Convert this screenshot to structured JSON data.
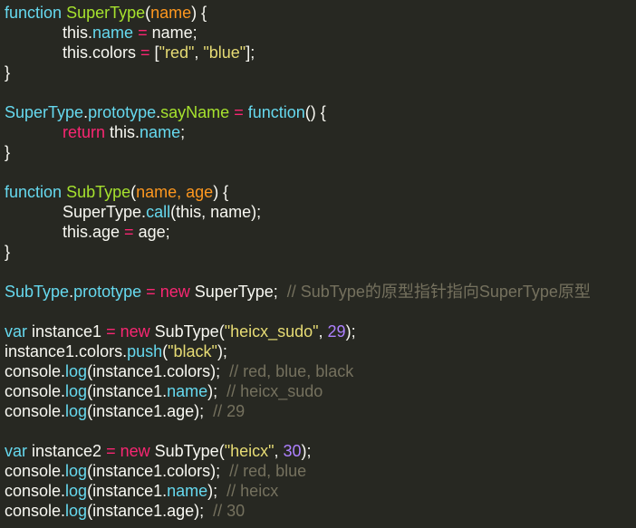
{
  "editor": {
    "theme_colors": {
      "background": "#272822",
      "text": "#f8f8f2",
      "keyword": "#66d9ef",
      "operator": "#f92672",
      "function_name": "#a6e22e",
      "parameter": "#fd971f",
      "string": "#e6db74",
      "number": "#ae81ff",
      "comment": "#75715e"
    },
    "lines": [
      [
        {
          "t": "function",
          "c": "kw-fn"
        },
        {
          "t": " ",
          "c": "plain"
        },
        {
          "t": "SuperType",
          "c": "fn-name"
        },
        {
          "t": "(",
          "c": "plain"
        },
        {
          "t": "name",
          "c": "param"
        },
        {
          "t": ") {",
          "c": "plain"
        }
      ],
      [
        {
          "t": "this.",
          "c": "plain"
        },
        {
          "t": "name",
          "c": "prop"
        },
        {
          "t": " ",
          "c": "plain"
        },
        {
          "t": "=",
          "c": "kw-red"
        },
        {
          "t": " name;",
          "c": "plain"
        }
      ],
      [
        {
          "t": "this.colors ",
          "c": "plain"
        },
        {
          "t": "=",
          "c": "kw-red"
        },
        {
          "t": " [",
          "c": "plain"
        },
        {
          "t": "\"red\"",
          "c": "str"
        },
        {
          "t": ", ",
          "c": "plain"
        },
        {
          "t": "\"blue\"",
          "c": "str"
        },
        {
          "t": "];",
          "c": "plain"
        }
      ],
      [
        {
          "t": "}",
          "c": "plain"
        }
      ],
      [],
      [
        {
          "t": "SuperType",
          "c": "prop"
        },
        {
          "t": ".",
          "c": "plain"
        },
        {
          "t": "prototype",
          "c": "prop"
        },
        {
          "t": ".",
          "c": "plain"
        },
        {
          "t": "sayName",
          "c": "fn-name"
        },
        {
          "t": " ",
          "c": "plain"
        },
        {
          "t": "=",
          "c": "kw-red"
        },
        {
          "t": " ",
          "c": "plain"
        },
        {
          "t": "function",
          "c": "kw-fn"
        },
        {
          "t": "() {",
          "c": "plain"
        }
      ],
      [
        {
          "t": "return",
          "c": "kw-red"
        },
        {
          "t": " this.",
          "c": "plain"
        },
        {
          "t": "name",
          "c": "prop"
        },
        {
          "t": ";",
          "c": "plain"
        }
      ],
      [
        {
          "t": "}",
          "c": "plain"
        }
      ],
      [],
      [
        {
          "t": "function",
          "c": "kw-fn"
        },
        {
          "t": " ",
          "c": "plain"
        },
        {
          "t": "SubType",
          "c": "fn-name"
        },
        {
          "t": "(",
          "c": "plain"
        },
        {
          "t": "name, age",
          "c": "param"
        },
        {
          "t": ") {",
          "c": "plain"
        }
      ],
      [
        {
          "t": "SuperType.",
          "c": "plain"
        },
        {
          "t": "call",
          "c": "prop"
        },
        {
          "t": "(this, name);",
          "c": "plain"
        }
      ],
      [
        {
          "t": "this.age ",
          "c": "plain"
        },
        {
          "t": "=",
          "c": "kw-red"
        },
        {
          "t": " age;",
          "c": "plain"
        }
      ],
      [
        {
          "t": "}",
          "c": "plain"
        }
      ],
      [],
      [
        {
          "t": "SubType",
          "c": "prop"
        },
        {
          "t": ".",
          "c": "plain"
        },
        {
          "t": "prototype",
          "c": "prop"
        },
        {
          "t": " ",
          "c": "plain"
        },
        {
          "t": "=",
          "c": "kw-red"
        },
        {
          "t": " ",
          "c": "plain"
        },
        {
          "t": "new",
          "c": "kw-red"
        },
        {
          "t": " SuperType;  ",
          "c": "plain"
        },
        {
          "t": "// SubType的原型指针指向SuperType原型",
          "c": "cmt"
        }
      ],
      [],
      [
        {
          "t": "var",
          "c": "kw-fn"
        },
        {
          "t": " instance1 ",
          "c": "plain"
        },
        {
          "t": "=",
          "c": "kw-red"
        },
        {
          "t": " ",
          "c": "plain"
        },
        {
          "t": "new",
          "c": "kw-red"
        },
        {
          "t": " SubType(",
          "c": "plain"
        },
        {
          "t": "\"heicx_sudo\"",
          "c": "str"
        },
        {
          "t": ", ",
          "c": "plain"
        },
        {
          "t": "29",
          "c": "num"
        },
        {
          "t": ");",
          "c": "plain"
        }
      ],
      [
        {
          "t": "instance1.colors.",
          "c": "plain"
        },
        {
          "t": "push",
          "c": "prop"
        },
        {
          "t": "(",
          "c": "plain"
        },
        {
          "t": "\"black\"",
          "c": "str"
        },
        {
          "t": ");",
          "c": "plain"
        }
      ],
      [
        {
          "t": "console.",
          "c": "plain"
        },
        {
          "t": "log",
          "c": "prop"
        },
        {
          "t": "(instance1.colors);  ",
          "c": "plain"
        },
        {
          "t": "// red, blue, black",
          "c": "cmt"
        }
      ],
      [
        {
          "t": "console.",
          "c": "plain"
        },
        {
          "t": "log",
          "c": "prop"
        },
        {
          "t": "(instance1.",
          "c": "plain"
        },
        {
          "t": "name",
          "c": "prop"
        },
        {
          "t": ");  ",
          "c": "plain"
        },
        {
          "t": "// heicx_sudo",
          "c": "cmt"
        }
      ],
      [
        {
          "t": "console.",
          "c": "plain"
        },
        {
          "t": "log",
          "c": "prop"
        },
        {
          "t": "(instance1.age);  ",
          "c": "plain"
        },
        {
          "t": "// 29",
          "c": "cmt"
        }
      ],
      [],
      [
        {
          "t": "var",
          "c": "kw-fn"
        },
        {
          "t": " instance2 ",
          "c": "plain"
        },
        {
          "t": "=",
          "c": "kw-red"
        },
        {
          "t": " ",
          "c": "plain"
        },
        {
          "t": "new",
          "c": "kw-red"
        },
        {
          "t": " SubType(",
          "c": "plain"
        },
        {
          "t": "\"heicx\"",
          "c": "str"
        },
        {
          "t": ", ",
          "c": "plain"
        },
        {
          "t": "30",
          "c": "num"
        },
        {
          "t": ");",
          "c": "plain"
        }
      ],
      [
        {
          "t": "console.",
          "c": "plain"
        },
        {
          "t": "log",
          "c": "prop"
        },
        {
          "t": "(instance1.colors);  ",
          "c": "plain"
        },
        {
          "t": "// red, blue",
          "c": "cmt"
        }
      ],
      [
        {
          "t": "console.",
          "c": "plain"
        },
        {
          "t": "log",
          "c": "prop"
        },
        {
          "t": "(instance1.",
          "c": "plain"
        },
        {
          "t": "name",
          "c": "prop"
        },
        {
          "t": ");  ",
          "c": "plain"
        },
        {
          "t": "// heicx",
          "c": "cmt"
        }
      ],
      [
        {
          "t": "console.",
          "c": "plain"
        },
        {
          "t": "log",
          "c": "prop"
        },
        {
          "t": "(instance1.age);  ",
          "c": "plain"
        },
        {
          "t": "// 30",
          "c": "cmt"
        }
      ]
    ]
  }
}
